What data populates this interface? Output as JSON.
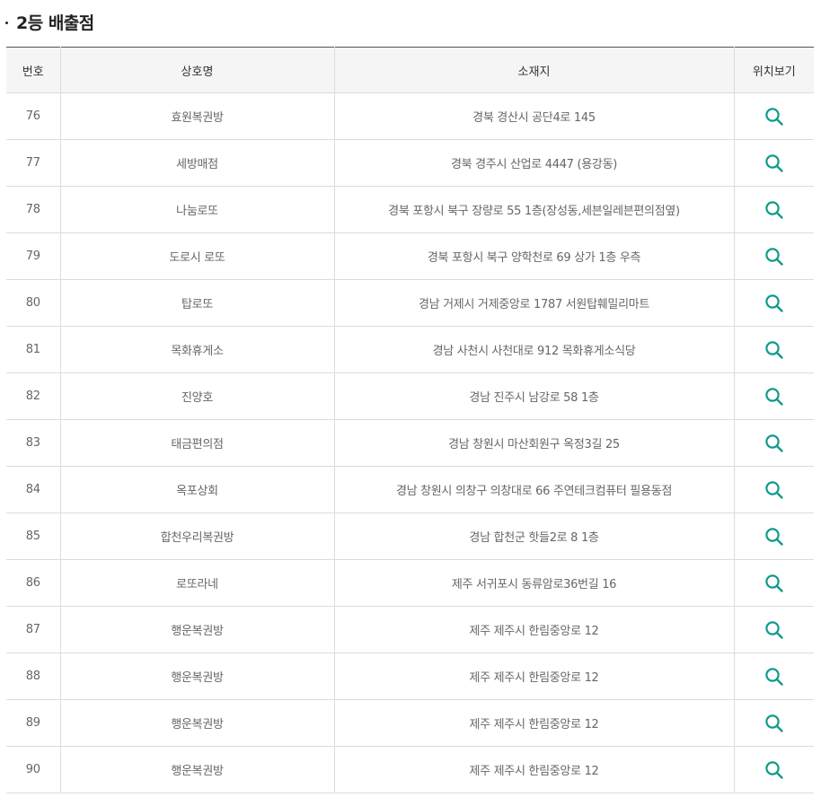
{
  "section": {
    "title": "2등 배출점"
  },
  "table": {
    "headers": {
      "number": "번호",
      "name": "상호명",
      "address": "소재지",
      "location": "위치보기"
    },
    "rows": [
      {
        "number": "76",
        "name": "효원복권방",
        "address": "경북 경산시 공단4로 145"
      },
      {
        "number": "77",
        "name": "세방매점",
        "address": "경북 경주시 산업로 4447 (용강동)"
      },
      {
        "number": "78",
        "name": "나눔로또",
        "address": "경북 포항시 북구 장량로 55 1층(장성동,세븐일레븐편의점옆)"
      },
      {
        "number": "79",
        "name": "도로시 로또",
        "address": "경북 포항시 북구 양학천로 69 상가 1층 우측"
      },
      {
        "number": "80",
        "name": "탑로또",
        "address": "경남 거제시 거제중앙로 1787 서원탑훼밀리마트"
      },
      {
        "number": "81",
        "name": "목화휴게소",
        "address": "경남 사천시 사천대로 912 목화휴게소식당"
      },
      {
        "number": "82",
        "name": "진양호",
        "address": "경남 진주시 남강로 58 1층"
      },
      {
        "number": "83",
        "name": "태금편의점",
        "address": "경남 창원시 마산회원구 옥정3길 25"
      },
      {
        "number": "84",
        "name": "옥포상회",
        "address": "경남 창원시 의창구 의창대로 66 주연테크컴퓨터 필용동점"
      },
      {
        "number": "85",
        "name": "합천우리복권방",
        "address": "경남 합천군 핫들2로 8 1층"
      },
      {
        "number": "86",
        "name": "로또라네",
        "address": "제주 서귀포시 동류암로36번길 16"
      },
      {
        "number": "87",
        "name": "행운복권방",
        "address": "제주 제주시 한림중앙로 12"
      },
      {
        "number": "88",
        "name": "행운복권방",
        "address": "제주 제주시 한림중앙로 12"
      },
      {
        "number": "89",
        "name": "행운복권방",
        "address": "제주 제주시 한림중앙로 12"
      },
      {
        "number": "90",
        "name": "행운복권방",
        "address": "제주 제주시 한림중앙로 12"
      }
    ],
    "location_icon": "search-icon"
  },
  "colors": {
    "accent": "#0f9a8a",
    "header_bg": "#f5f5f5",
    "border": "#dcdcdc",
    "top_border": "#555555"
  }
}
